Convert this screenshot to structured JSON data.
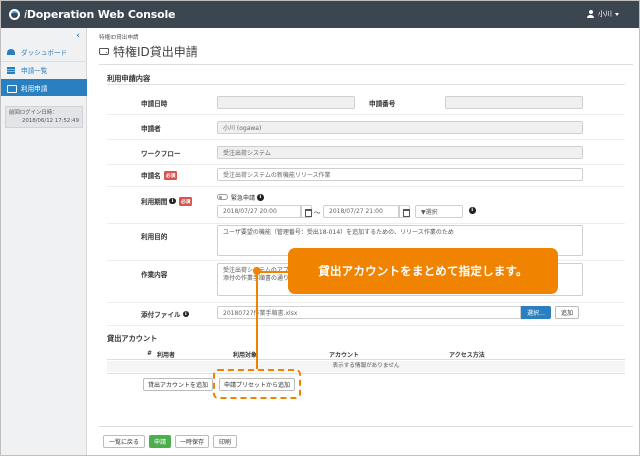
{
  "app": {
    "brand_i": "i",
    "brand_rest": "Doperation Web Console"
  },
  "user": {
    "name": "小川"
  },
  "sidebar": {
    "collapse_glyph": "‹",
    "items": [
      {
        "label": "ダッシュボード"
      },
      {
        "label": "申請一覧"
      },
      {
        "label": "利用申請"
      }
    ],
    "last_login_label": "前回ログイン日時：",
    "last_login_value": "2018/06/12 17:52:49"
  },
  "page": {
    "breadcrumb": "特権ID貸出申請",
    "title": "特権ID貸出申請"
  },
  "form": {
    "section_title": "利用申請内容",
    "application_date_label": "申請日時",
    "application_date_value": "",
    "application_no_label": "申請番号",
    "application_no_value": "",
    "applicant_label": "申請者",
    "applicant_value": "小川 (ogawa)",
    "workflow_label": "ワークフロー",
    "workflow_value": "受注出荷システム",
    "name_label": "申請名",
    "required_badge": "必須",
    "name_value": "受注出荷システムの新機能リリース作業",
    "period_label": "利用期間",
    "info_glyph": "i",
    "urgent_label": "緊急申請",
    "start_datetime": "2018/07/27 20:00",
    "tilde": "〜",
    "end_datetime": "2018/07/27 21:00",
    "select_placeholder": "▼選択",
    "purpose_label": "利用目的",
    "purpose_value": "ユーザ要望の機能（管理番号：受出18-014）を追加するための、リリース作業のため",
    "work_label": "作業内容",
    "work_value_line1": "受注出荷システムのアプリ",
    "work_value_line2": "添付の作業手順書の通り",
    "attachment_label": "添付ファイル",
    "attachment_value": "20180727作業手順書.xlsx",
    "select_button": "選択...",
    "add_button": "追加"
  },
  "accounts": {
    "section_title": "貸出アカウント",
    "columns": [
      "#",
      "利用者",
      "利用対象",
      "アカウント",
      "アクセス方法"
    ],
    "empty_message": "表示する情報がありません",
    "add_account_button": "貸出アカウントを追加",
    "add_preset_button": "申請プリセットから追加"
  },
  "footer": {
    "back_button": "一覧に戻る",
    "submit_button": "申請",
    "save_button": "一時保存",
    "print_button": "印刷"
  },
  "callout": {
    "text": "貸出アカウントをまとめて指定します。",
    "color": "#f08300"
  },
  "colors": {
    "topbar": "#3c4650",
    "accent": "#2a7fc1",
    "submit": "#4cae4c",
    "required": "#d9534f"
  }
}
